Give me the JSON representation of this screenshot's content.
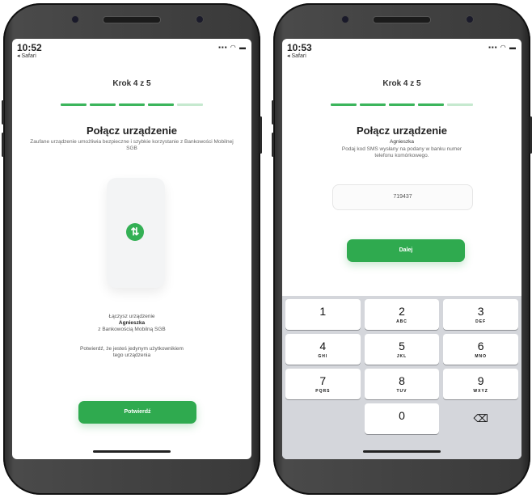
{
  "phone_left": {
    "status": {
      "time": "10:52",
      "back": "◂ Safari",
      "icons": "▪▪▪ ◠ ▬"
    },
    "step": "Krok 4 z 5",
    "progress_done": 4,
    "progress_total": 5,
    "title": "Połącz urządzenie",
    "subtitle": "Zaufane urządzenie umożliwia bezpieczne i szybkie korzystanie z Bankowości Mobilnej SGB",
    "sync_icon": "sync-arrows",
    "info_line1": "Łączysz urządzenie",
    "info_name": "Agnieszka",
    "info_line3": "z Bankowością Mobilną SGB",
    "confirm_text": "Potwierdź, że jesteś jedynym użytkownikiem tego urządzenia",
    "button": "Potwierdź"
  },
  "phone_right": {
    "status": {
      "time": "10:53",
      "back": "◂ Safari",
      "icons": "▪▪▪ ◠ ▬"
    },
    "step": "Krok 4 z 5",
    "progress_done": 4,
    "progress_total": 5,
    "title": "Połącz urządzenie",
    "name": "Agnieszka",
    "instruction": "Podaj kod SMS wysłany na podany w banku numer telefonu komórkowego.",
    "code_value": "719437",
    "button": "Dalej",
    "keys": [
      {
        "d": "1",
        "l": ""
      },
      {
        "d": "2",
        "l": "ABC"
      },
      {
        "d": "3",
        "l": "DEF"
      },
      {
        "d": "4",
        "l": "GHI"
      },
      {
        "d": "5",
        "l": "JKL"
      },
      {
        "d": "6",
        "l": "MNO"
      },
      {
        "d": "7",
        "l": "PQRS"
      },
      {
        "d": "8",
        "l": "TUV"
      },
      {
        "d": "9",
        "l": "WXYZ"
      },
      {
        "d": "",
        "l": ""
      },
      {
        "d": "0",
        "l": ""
      },
      {
        "d": "⌫",
        "l": ""
      }
    ],
    "delete_icon": "backspace"
  },
  "colors": {
    "accent": "#2faa4f",
    "progress_off": "#c6e9cf"
  }
}
